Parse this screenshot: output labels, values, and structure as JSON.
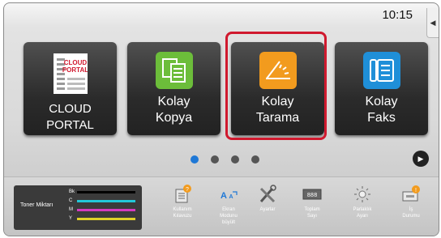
{
  "status": {
    "time": "10:15"
  },
  "tiles": [
    {
      "label": "CLOUD PORTAL",
      "logo_text": "CLOUD PORTAL"
    },
    {
      "label_line1": "Kolay",
      "label_line2": "Kopya"
    },
    {
      "label_line1": "Kolay",
      "label_line2": "Tarama",
      "selected": true
    },
    {
      "label_line1": "Kolay",
      "label_line2": "Faks"
    }
  ],
  "pager": {
    "pages": 4,
    "current": 1
  },
  "toner": {
    "label": "Toner Miktarı",
    "channels": [
      {
        "key": "Bk",
        "color": "#000000"
      },
      {
        "key": "C",
        "color": "#22c7d9"
      },
      {
        "key": "M",
        "color": "#d53ac0"
      },
      {
        "key": "Y",
        "color": "#e0d22a"
      }
    ]
  },
  "bottom_items": [
    {
      "label_line1": "Kullanım",
      "label_line2": "Kılavuzu",
      "label_line3": "",
      "icon": "manual-icon"
    },
    {
      "label_line1": "Ekran",
      "label_line2": "Modunu",
      "label_line3": "büyült",
      "icon": "enlarge-display-icon"
    },
    {
      "label_line1": "Ayarlar",
      "label_line2": "",
      "label_line3": "",
      "icon": "settings-tools-icon"
    },
    {
      "label_line1": "Toplam",
      "label_line2": "Sayı",
      "label_line3": "",
      "icon": "total-count-icon"
    },
    {
      "label_line1": "Parlaklık",
      "label_line2": "Ayarı",
      "label_line3": "",
      "icon": "brightness-icon"
    },
    {
      "label_line1": "İş",
      "label_line2": "Durumu",
      "label_line3": "",
      "icon": "job-status-icon"
    }
  ],
  "colors": {
    "accent_blue": "#1f78d6",
    "selection_red": "#d0192e",
    "scan_orange": "#f29b1e"
  }
}
